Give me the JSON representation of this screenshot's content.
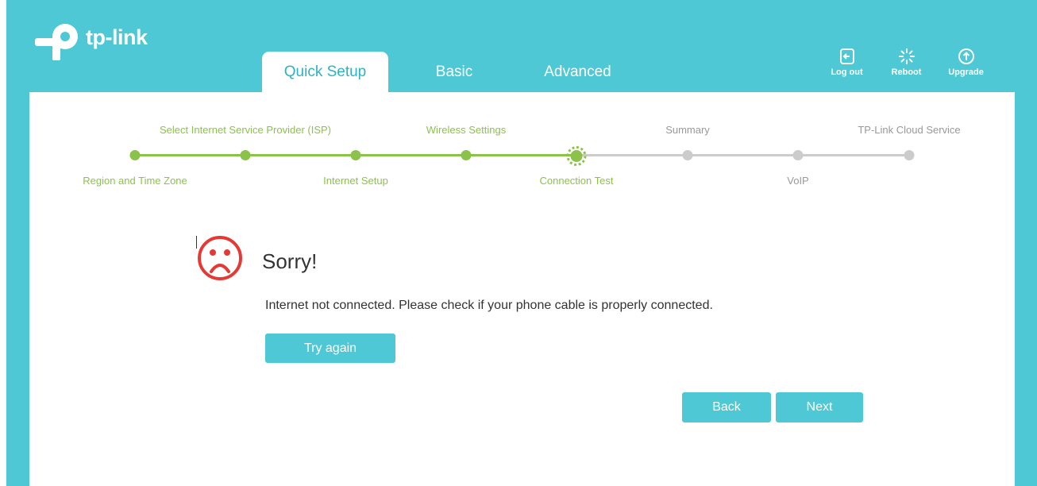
{
  "brand": {
    "name": "tp-link"
  },
  "tabs": [
    {
      "label": "Quick Setup",
      "active": true
    },
    {
      "label": "Basic",
      "active": false
    },
    {
      "label": "Advanced",
      "active": false
    }
  ],
  "actions": [
    {
      "label": "Log out",
      "icon": "logout-icon"
    },
    {
      "label": "Reboot",
      "icon": "reboot-icon"
    },
    {
      "label": "Upgrade",
      "icon": "upgrade-icon"
    }
  ],
  "steps": [
    {
      "label": "Region and Time Zone",
      "state": "done"
    },
    {
      "label": "Select Internet Service Provider (ISP)",
      "state": "done"
    },
    {
      "label": "Internet Setup",
      "state": "done"
    },
    {
      "label": "Wireless Settings",
      "state": "done"
    },
    {
      "label": "Connection Test",
      "state": "current"
    },
    {
      "label": "Summary",
      "state": "todo"
    },
    {
      "label": "VoIP",
      "state": "todo"
    },
    {
      "label": "TP-Link Cloud Service",
      "state": "todo"
    }
  ],
  "result": {
    "icon": "sad-face-icon",
    "title": "Sorry!",
    "message": "Internet not connected. Please check if your phone cable is properly connected.",
    "retry_label": "Try again"
  },
  "nav": {
    "back_label": "Back",
    "next_label": "Next"
  },
  "colors": {
    "header": "#4dc8d4",
    "progress": "#8bc34a",
    "error": "#e53935",
    "inactive": "#cccccc"
  }
}
